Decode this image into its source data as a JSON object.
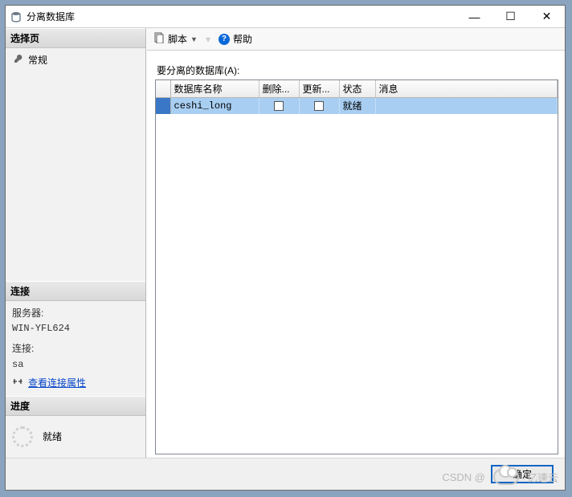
{
  "window": {
    "title": "分离数据库",
    "minimize": "—",
    "maximize": "☐",
    "close": "✕"
  },
  "left": {
    "select_page_hdr": "选择页",
    "page_general": "常规",
    "connection_hdr": "连接",
    "server_label": "服务器:",
    "server_value": "WIN-YFL624",
    "conn_label": "连接:",
    "conn_value": "sa",
    "view_props": "查看连接属性",
    "progress_hdr": "进度",
    "progress_status": "就绪"
  },
  "toolbar": {
    "script": "脚本",
    "help": "帮助"
  },
  "main": {
    "label": "要分离的数据库(A):",
    "headers": {
      "rowhdr": "",
      "name": "数据库名称",
      "drop": "删除...",
      "update": "更新...",
      "status": "状态",
      "message": "消息"
    },
    "rows": [
      {
        "name": "ceshi_long",
        "drop": false,
        "update": false,
        "status": "就绪",
        "message": ""
      }
    ]
  },
  "footer": {
    "ok": "确定"
  },
  "watermark": {
    "csdn": "CSDN @",
    "ysy": "亿速云"
  }
}
